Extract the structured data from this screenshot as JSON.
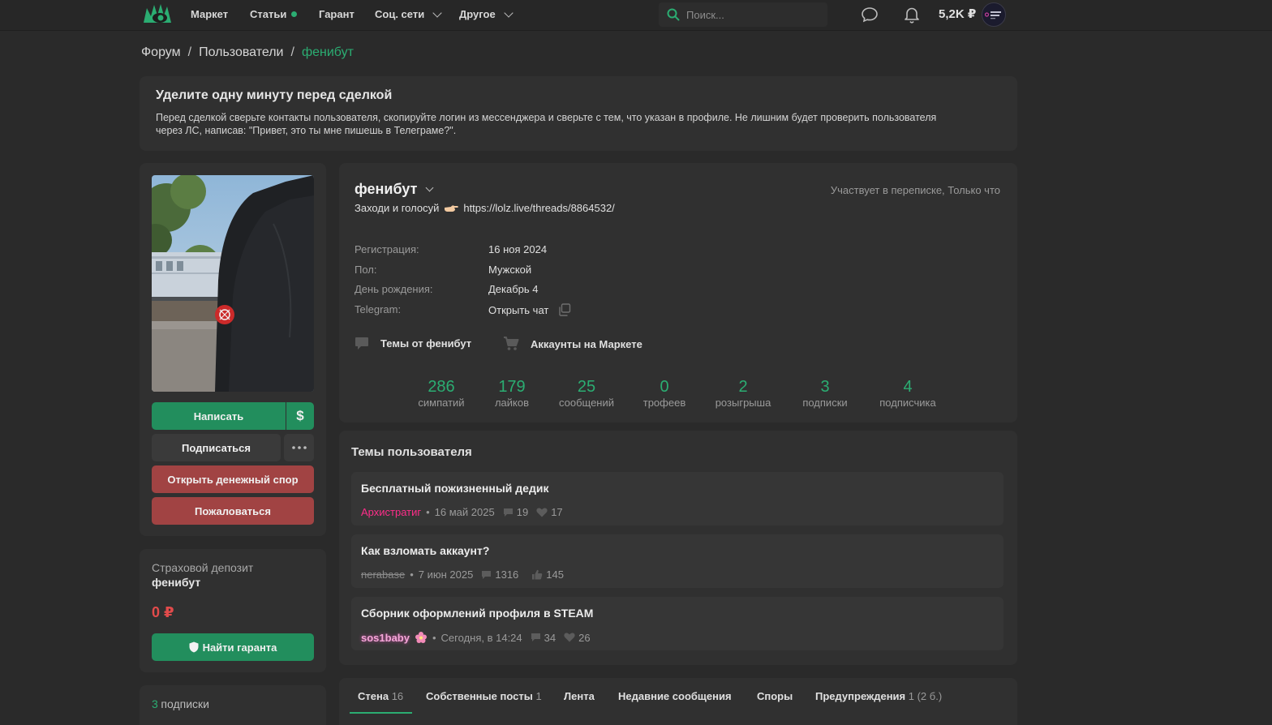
{
  "nav": {
    "items": [
      {
        "label": "Маркет"
      },
      {
        "label": "Статьи"
      },
      {
        "label": "Гарант"
      },
      {
        "label": "Соц. сети"
      },
      {
        "label": "Другое"
      }
    ],
    "search_placeholder": "Поиск...",
    "balance": "5,2K ₽",
    "colors": {
      "accent": "#2bad72",
      "bg": "#2a2a2a",
      "card": "#303030"
    }
  },
  "breadcrumb": {
    "items": [
      "Форум",
      "Пользователи"
    ],
    "current": "фенибут",
    "sep": "/"
  },
  "notice": {
    "title": "Уделите одну минуту перед сделкой",
    "text": "Перед сделкой сверьте контакты пользователя, скопируйте логин из мессенджера и сверьте с тем, что указан в профиле. Не лишним будет проверить пользователя через ЛС, написав: \"Привет, это ты мне пишешь в Телеграме?\"."
  },
  "actions": {
    "write": "Написать",
    "currency": "$",
    "subscribe": "Подписаться",
    "dispute": "Открыть денежный спор",
    "report": "Пожаловаться"
  },
  "insurance": {
    "label": "Страховой депозит",
    "user": "фенибут",
    "amount": "0 ₽",
    "find_guarantor": "Найти гаранта"
  },
  "subscriptions": {
    "count": "3",
    "label": "подписки"
  },
  "profile": {
    "username": "фенибут",
    "status": "Участвует в переписке, Только что",
    "tagline_text": "Заходи и голосуй",
    "tagline_link": "https://lolz.live/threads/8864532/",
    "info": [
      {
        "label": "Регистрация:",
        "value": "16 ноя 2024"
      },
      {
        "label": "Пол:",
        "value": "Мужской"
      },
      {
        "label": "День рождения:",
        "value": "Декабрь 4"
      },
      {
        "label": "Telegram:",
        "value": "Открыть чат"
      }
    ],
    "links": {
      "threads": "Темы от фенибут",
      "market": "Аккаунты на Маркете"
    },
    "stats": [
      {
        "num": "286",
        "label": "симпатий"
      },
      {
        "num": "179",
        "label": "лайков"
      },
      {
        "num": "25",
        "label": "сообщений"
      },
      {
        "num": "0",
        "label": "трофеев"
      },
      {
        "num": "2",
        "label": "розыгрыша"
      },
      {
        "num": "3",
        "label": "подписки"
      },
      {
        "num": "4",
        "label": "подписчика"
      }
    ]
  },
  "threads": {
    "title": "Темы пользователя",
    "items": [
      {
        "title": "Бесплатный пожизненный дедик",
        "author": "Архистратиг",
        "date": "16 май 2025",
        "replies": "19",
        "likes": "17"
      },
      {
        "title": "Как взломать аккаунт?",
        "author": "nerabase",
        "date": "7 июн 2025",
        "replies": "1316",
        "likes": "145"
      },
      {
        "title": "Сборник оформлений профиля в STEAM",
        "author": "sos1baby",
        "date": "Сегодня, в 14:24",
        "replies": "34",
        "likes": "26"
      }
    ]
  },
  "tabs": [
    {
      "label": "Стена",
      "count": "16"
    },
    {
      "label": "Собственные посты",
      "count": "1"
    },
    {
      "label": "Лента",
      "count": ""
    },
    {
      "label": "Недавние сообщения",
      "count": ""
    },
    {
      "label": "Споры",
      "count": ""
    },
    {
      "label": "Предупреждения",
      "count": "1 (2 б.)"
    }
  ]
}
